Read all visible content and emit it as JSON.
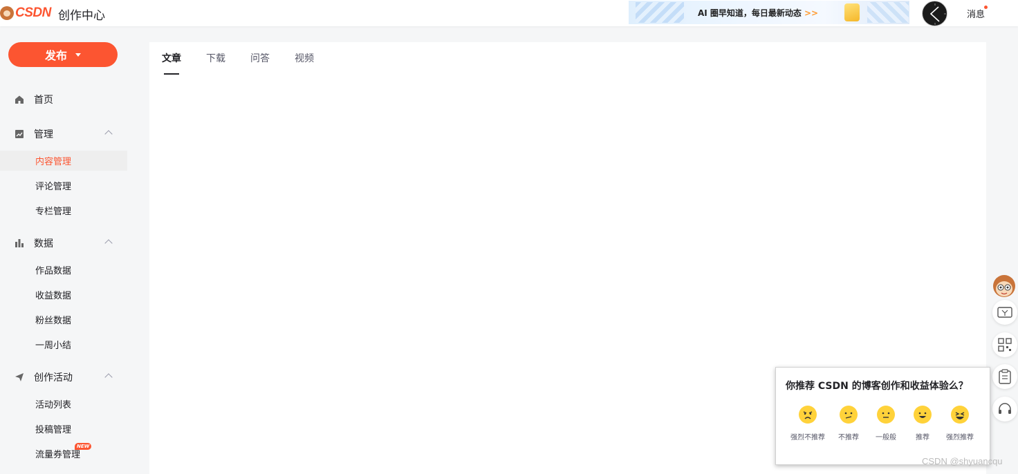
{
  "header": {
    "logo_text": "CSDN",
    "app_title": "创作中心",
    "banner_text": "AI 圈早知道，每日最新动态",
    "banner_arrow": ">>",
    "messages_label": "消息"
  },
  "sidebar": {
    "publish_label": "发布",
    "home_label": "首页",
    "groups": [
      {
        "label": "管理",
        "items": [
          "内容管理",
          "评论管理",
          "专栏管理"
        ]
      },
      {
        "label": "数据",
        "items": [
          "作品数据",
          "收益数据",
          "粉丝数据",
          "一周小结"
        ]
      },
      {
        "label": "创作活动",
        "items": [
          "活动列表",
          "投稿管理",
          "流量券管理"
        ]
      }
    ],
    "active_item": "内容管理",
    "new_badge": "NEW"
  },
  "main": {
    "tabs": [
      "文章",
      "下载",
      "问答",
      "视频"
    ],
    "active_tab": "文章"
  },
  "survey": {
    "title": "你推荐 CSDN 的博客创作和收益体验么？",
    "options": [
      "强烈不推荐",
      "不推荐",
      "一般般",
      "推荐",
      "强烈推荐"
    ]
  },
  "float_buttons": [
    "coupon-icon",
    "qrcode-icon",
    "clipboard-icon",
    "headset-icon"
  ],
  "watermark": "CSDN @shyuancqu",
  "colors": {
    "accent": "#fc5531",
    "emoji": "#ffd23a"
  }
}
